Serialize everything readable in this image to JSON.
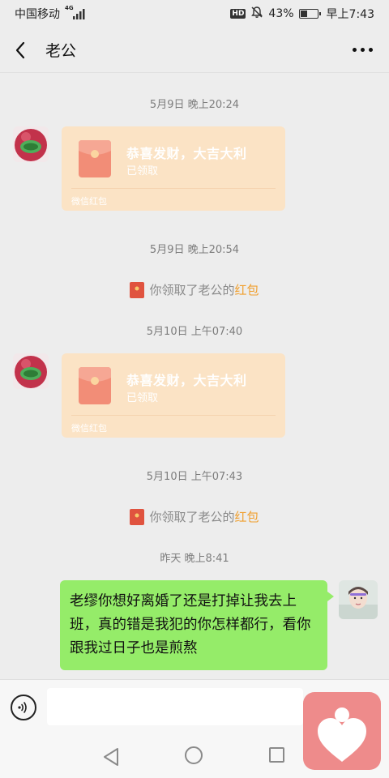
{
  "status_bar": {
    "carrier": "中国移动",
    "network": "4G",
    "hd": "HD",
    "battery_percent": "43%",
    "battery_level": 0.43,
    "time": "早上7:43"
  },
  "header": {
    "title": "老公"
  },
  "messages": [
    {
      "type": "timestamp",
      "text": "5月9日 晚上20:24"
    },
    {
      "type": "red_packet",
      "title": "恭喜发财，大吉大利",
      "status": "已领取",
      "footer": "微信红包"
    },
    {
      "type": "timestamp",
      "text": "5月9日 晚上20:54"
    },
    {
      "type": "system",
      "prefix": "你领取了老公的",
      "link": "红包"
    },
    {
      "type": "timestamp",
      "text": "5月10日 上午07:40"
    },
    {
      "type": "red_packet",
      "title": "恭喜发财，大吉大利",
      "status": "已领取",
      "footer": "微信红包"
    },
    {
      "type": "timestamp",
      "text": "5月10日 上午07:43"
    },
    {
      "type": "system",
      "prefix": "你领取了老公的",
      "link": "红包"
    },
    {
      "type": "timestamp",
      "text": "昨天 晚上8:41"
    },
    {
      "type": "text_out",
      "text": "老缪你想好离婚了还是打掉让我去上班，真的错是我犯的你怎样都行，看你跟我过日子也是煎熬"
    }
  ],
  "colors": {
    "background": "#ededed",
    "red_packet": "#fbe3c5",
    "bubble_out": "#95ec69",
    "link": "#f0a030",
    "app_logo": "#ee8b8b"
  },
  "icons": [
    "back-arrow-icon",
    "more-dots-icon",
    "red-packet-icon",
    "voice-icon",
    "nav-back-icon",
    "nav-home-icon",
    "nav-recent-icon",
    "heart-logo-icon"
  ]
}
